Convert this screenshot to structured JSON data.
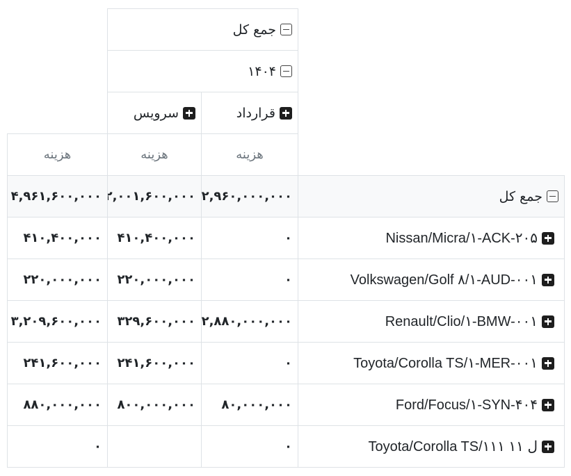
{
  "header": {
    "grand_total": "جمع کل",
    "year": "۱۴۰۴",
    "col_contract": "قرارداد",
    "col_service": "سرویس",
    "measure": "هزینه"
  },
  "totals_row": {
    "label": "جمع کل",
    "contract": "۲,۹۶۰,۰۰۰,۰۰۰",
    "service": "۲,۰۰۱,۶۰۰,۰۰۰",
    "total": "۴,۹۶۱,۶۰۰,۰۰۰"
  },
  "rows": [
    {
      "label": "Nissan/Micra/۱-ACK-۲۰۵",
      "contract": "۰",
      "service": "۴۱۰,۴۰۰,۰۰۰",
      "total": "۴۱۰,۴۰۰,۰۰۰"
    },
    {
      "label": "Volkswagen/Golf ۸/۱-AUD-۰۰۱",
      "contract": "۰",
      "service": "۲۲۰,۰۰۰,۰۰۰",
      "total": "۲۲۰,۰۰۰,۰۰۰"
    },
    {
      "label": "Renault/Clio/۱-BMW-۰۰۱",
      "contract": "۲,۸۸۰,۰۰۰,۰۰۰",
      "service": "۳۲۹,۶۰۰,۰۰۰",
      "total": "۳,۲۰۹,۶۰۰,۰۰۰"
    },
    {
      "label": "Toyota/Corolla TS/۱-MER-۰۰۱",
      "contract": "۰",
      "service": "۲۴۱,۶۰۰,۰۰۰",
      "total": "۲۴۱,۶۰۰,۰۰۰"
    },
    {
      "label": "Ford/Focus/۱-SYN-۴۰۴",
      "contract": "۸۰,۰۰۰,۰۰۰",
      "service": "۸۰۰,۰۰۰,۰۰۰",
      "total": "۸۸۰,۰۰۰,۰۰۰"
    },
    {
      "label": "Toyota/Corolla TS/۱۱۱ ل ۱۱",
      "contract": "۰",
      "service": "",
      "total": "۰"
    }
  ],
  "icons": {
    "collapse": "minus-square-icon",
    "expand": "plus-square-icon"
  },
  "colors": {
    "border": "#dee2e6",
    "row_header_bg": "#f8f9fa",
    "measure_text": "#6c757d",
    "text": "#212529"
  }
}
